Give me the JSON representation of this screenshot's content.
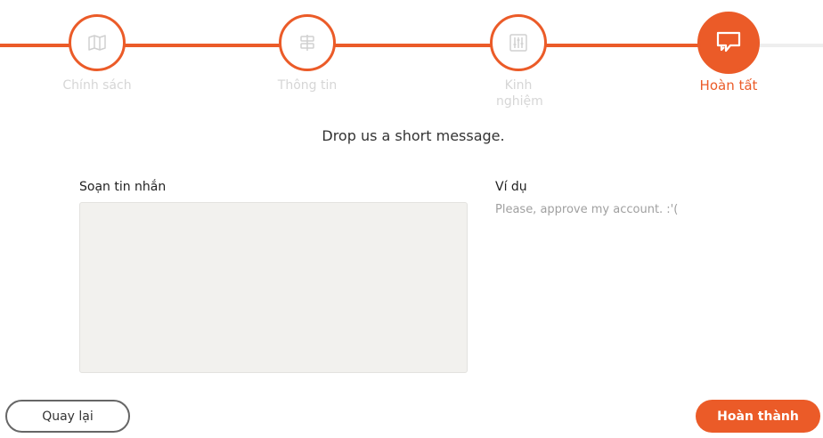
{
  "colors": {
    "accent": "#eb5b28",
    "inactive_label": "#d6d6d6",
    "textarea_bg": "#f2f1ee"
  },
  "stepper": {
    "steps": [
      {
        "label": "Chính sách",
        "icon": "map-icon",
        "state": "completed"
      },
      {
        "label": "Thông tin",
        "icon": "signpost-icon",
        "state": "completed"
      },
      {
        "label": "Kinh nghiệm",
        "icon": "sliders-icon",
        "state": "completed"
      },
      {
        "label": "Hoàn tất",
        "icon": "chat-bubble-icon",
        "state": "active"
      }
    ]
  },
  "main": {
    "subtitle": "Drop us a short message.",
    "message_label": "Soạn tin nhắn",
    "message_value": "",
    "example_title": "Ví dụ",
    "example_text": "Please, approve my account. :'("
  },
  "footer": {
    "back_label": "Quay lại",
    "finish_label": "Hoàn thành"
  }
}
